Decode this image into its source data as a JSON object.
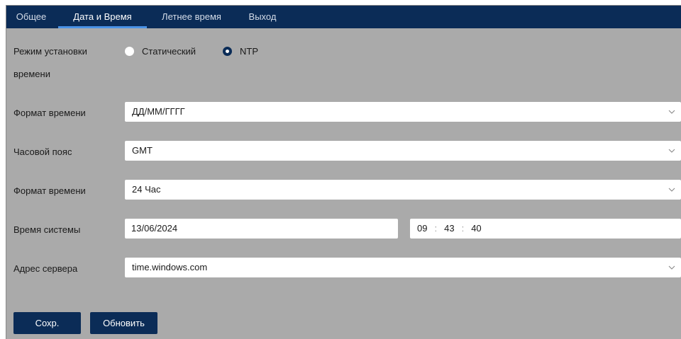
{
  "tabs": [
    {
      "label": "Общее"
    },
    {
      "label": "Дата и Время"
    },
    {
      "label": "Летнее время"
    },
    {
      "label": "Выход"
    }
  ],
  "active_tab_index": 1,
  "colors": {
    "header_bg": "#0b2c57",
    "active_tab_underline": "#4a92e6",
    "panel_bg": "#aaaaaa",
    "button_bg": "#0b2c57"
  },
  "form": {
    "time_mode": {
      "label_line1": "Режим установки",
      "label_line2": "времени",
      "options": [
        {
          "label": "Статический",
          "checked": false
        },
        {
          "label": "NTP",
          "checked": true
        }
      ]
    },
    "date_format": {
      "label": "Формат времени",
      "value": "ДД/ММ/ГГГГ"
    },
    "timezone": {
      "label": "Часовой пояс",
      "value": "GMT"
    },
    "time_format": {
      "label": "Формат времени",
      "value": "24 Час"
    },
    "system_time": {
      "label": "Время системы",
      "date": "13/06/2024",
      "hours": "09",
      "minutes": "43",
      "seconds": "40",
      "separator": ":"
    },
    "server_address": {
      "label": "Адрес сервера",
      "value": "time.windows.com"
    }
  },
  "buttons": {
    "save": "Сохр.",
    "refresh": "Обновить"
  },
  "icons": {
    "dropdown": "chevron-down-icon"
  }
}
